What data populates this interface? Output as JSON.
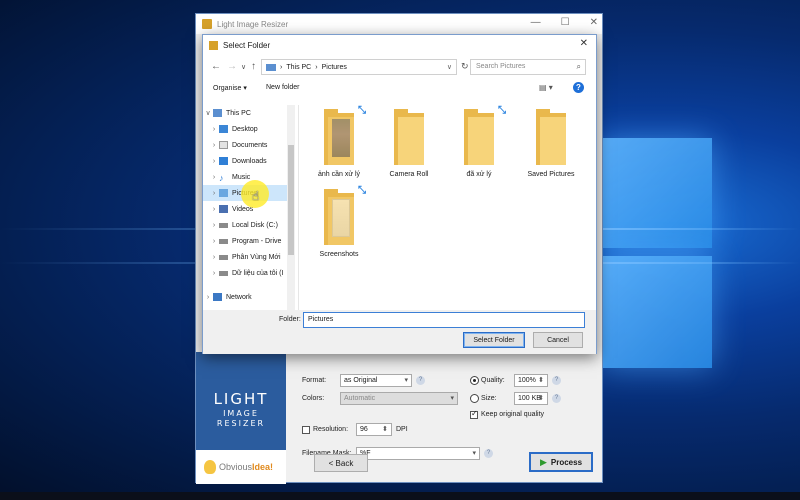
{
  "app": {
    "title": "Light Image Resizer",
    "brand": [
      "LIGHT",
      "IMAGE",
      "RESIZER"
    ],
    "company_prefix": "Obvious",
    "company_suffix": "Idea!",
    "options": {
      "format_label": "Format:",
      "format_value": "as Original",
      "colors_label": "Colors:",
      "colors_value": "Automatic",
      "resolution_label": "Resolution:",
      "resolution_value": "96",
      "resolution_unit": "DPI",
      "filename_label": "Filename Mask:",
      "filename_value": "%F",
      "quality_label": "Quality:",
      "quality_value": "100%",
      "size_label": "Size:",
      "size_value": "100 KB",
      "keep_quality_label": "Keep original quality"
    },
    "back_label": "< Back",
    "process_label": "Process"
  },
  "dialog": {
    "title": "Select Folder",
    "path": [
      "This PC",
      "Pictures"
    ],
    "search_placeholder": "Search Pictures",
    "organise_label": "Organise ▾",
    "new_folder_label": "New folder",
    "tree": [
      {
        "label": "This PC",
        "level": 0,
        "icon": "pc-icon",
        "expanded": true
      },
      {
        "label": "Desktop",
        "level": 1,
        "icon": "desktop-icon"
      },
      {
        "label": "Documents",
        "level": 1,
        "icon": "documents-icon"
      },
      {
        "label": "Downloads",
        "level": 1,
        "icon": "downloads-icon"
      },
      {
        "label": "Music",
        "level": 1,
        "icon": "music-icon"
      },
      {
        "label": "Pictures",
        "level": 1,
        "icon": "pictures-icon",
        "selected": true
      },
      {
        "label": "Videos",
        "level": 1,
        "icon": "videos-icon"
      },
      {
        "label": "Local Disk (C:)",
        "level": 1,
        "icon": "disk-icon"
      },
      {
        "label": "Program - Drive",
        "level": 1,
        "icon": "disk-icon"
      },
      {
        "label": "Phân Vùng Mới",
        "level": 1,
        "icon": "disk-icon"
      },
      {
        "label": "Dữ liệu của tôi (I",
        "level": 1,
        "icon": "disk-icon"
      },
      {
        "label": "Network",
        "level": 0,
        "icon": "network-icon"
      }
    ],
    "folders": [
      {
        "name": "ảnh cần xử lý",
        "thumb": "dark",
        "shared": true
      },
      {
        "name": "Camera Roll",
        "thumb": "none",
        "shared": false
      },
      {
        "name": "đã xử lý",
        "thumb": "none",
        "shared": true
      },
      {
        "name": "Saved Pictures",
        "thumb": "none",
        "shared": false
      },
      {
        "name": "Screenshots",
        "thumb": "light",
        "shared": true
      }
    ],
    "folder_label": "Folder:",
    "folder_value": "Pictures",
    "select_button": "Select Folder",
    "cancel_button": "Cancel"
  },
  "colors": {
    "accent": "#2b6cc7",
    "folder": "#f7d47a",
    "brand_panel": "#2b5c9e"
  }
}
